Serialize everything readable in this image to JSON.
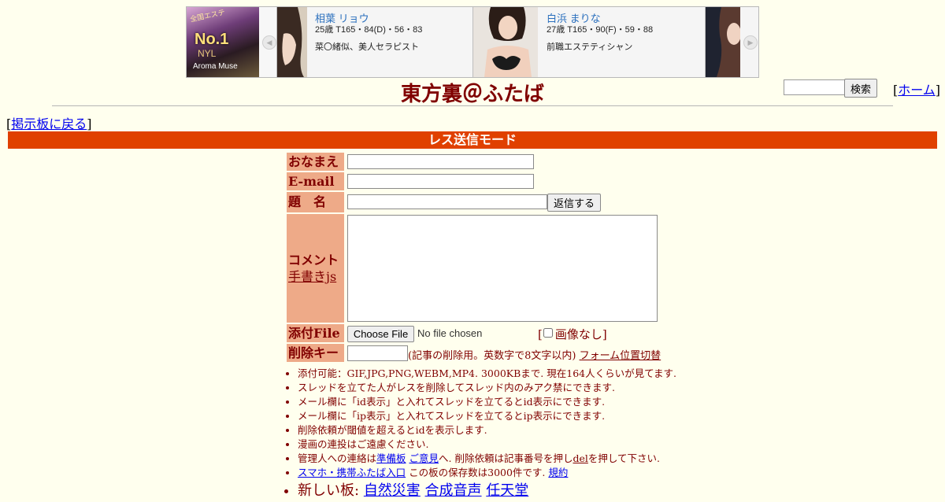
{
  "ad": {
    "logo": {
      "line1": "全国エステ",
      "line2": "No.1",
      "line3": "NYL",
      "line4": "Aroma Muse"
    },
    "cards": [
      {
        "name": "相葉 リョウ",
        "spec": "25歳 T165・84(D)・56・83",
        "desc": "菜〇緒似、美人セラピスト"
      },
      {
        "name": "白浜 まりな",
        "spec": "27歳 T165・90(F)・59・88",
        "desc": "前職エステティシャン"
      }
    ],
    "prev_arrow": "◀",
    "next_arrow": "▶"
  },
  "header": {
    "title": "東方裏＠ふたば",
    "search_button": "検索",
    "home_link": "ホーム",
    "back_link": "掲示板に戻る"
  },
  "mode_bar": "レス送信モード",
  "form": {
    "name_label": "おなまえ",
    "email_label": "E-mail",
    "subject_label": "題　名",
    "reply_button": "返信する",
    "comment_label": "コメント",
    "handwriting_link": "手書きjs",
    "file_label": "添付File",
    "choose_file": "Choose File",
    "no_file": "No file chosen",
    "no_image_label": "画像なし",
    "delete_key_label": "削除キー",
    "delete_note": "(記事の削除用。英数字で8文字以内)",
    "form_toggle": "フォーム位置切替"
  },
  "notes": {
    "upload": "添付可能：GIF,JPG,PNG,WEBM,MP4. 3000KBまで. 現在164人くらいが見てます.",
    "thread_owner": "スレッドを立てた人がレスを削除してスレッド内のみアク禁にできます.",
    "id_display": "メール欄に「id表示」と入れてスレッドを立てるとid表示にできます.",
    "ip_display": "メール欄に「ip表示」と入れてスレッドを立てるとip表示にできます.",
    "delete_threshold": "削除依頼が閾値を超えるとidを表示します.",
    "manga": "漫画の連投はご遠慮ください.",
    "contact_prefix": "管理人への連絡は",
    "contact_link1": "準備板",
    "contact_link2": "ご意見",
    "contact_mid": "へ. 削除依頼は記事番号を押し",
    "contact_del": "del",
    "contact_suffix": "を押して下さい.",
    "mobile_link": "スマホ・携帯ふたば入口",
    "storage": " この板の保存数は3000件です.",
    "rules_link": "規約",
    "new_boards_label": "新しい板:",
    "new_boards": [
      "自然災害",
      "合成音声",
      "任天堂"
    ]
  }
}
